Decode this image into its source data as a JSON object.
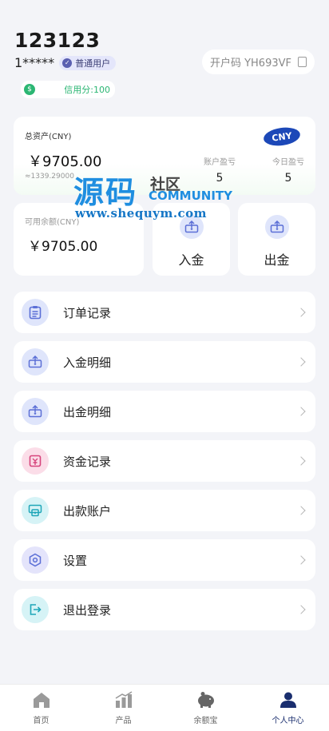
{
  "header": {
    "username": "123123",
    "masked_account": "1*****",
    "badge": "普通用户",
    "invite_label": "开户码 YH693VF",
    "credit_label": "信用分:100"
  },
  "asset": {
    "label": "总资产(CNY)",
    "amount": "￥9705.00",
    "sub_value": "≈1339.29000",
    "currency_pill": "CNY",
    "stats": [
      {
        "label": "账户盈亏",
        "value": "5"
      },
      {
        "label": "今日盈亏",
        "value": "5"
      }
    ]
  },
  "watermark": {
    "big": "源码",
    "she": "社区",
    "community": "COMMUNITY",
    "url": "www.shequym.com"
  },
  "available": {
    "label": "可用余额(CNY)",
    "amount": "￥9705.00"
  },
  "actions": {
    "deposit": "入金",
    "withdraw": "出金"
  },
  "menu": [
    {
      "label": "订单记录",
      "icon": "clipboard-icon",
      "bg": "#dfe5fb"
    },
    {
      "label": "入金明细",
      "icon": "deposit-box-icon",
      "bg": "#dfe5fb"
    },
    {
      "label": "出金明细",
      "icon": "withdraw-box-icon",
      "bg": "#dfe5fb"
    },
    {
      "label": "资金记录",
      "icon": "fund-record-icon",
      "bg": "#fbdde8"
    },
    {
      "label": "出款账户",
      "icon": "atm-icon",
      "bg": "#d6f3f6"
    },
    {
      "label": "设置",
      "icon": "settings-hexagon-icon",
      "bg": "#e4e4fb"
    },
    {
      "label": "退出登录",
      "icon": "logout-icon",
      "bg": "#d6f3f6"
    }
  ],
  "tabs": [
    {
      "label": "首页",
      "icon": "home-icon"
    },
    {
      "label": "产品",
      "icon": "chart-bars-icon"
    },
    {
      "label": "余额宝",
      "icon": "piggy-bank-icon"
    },
    {
      "label": "个人中心",
      "icon": "person-icon"
    }
  ],
  "colors": {
    "accent": "#1c48b8",
    "credit_green": "#2bb673",
    "watermark_blue": "#1f8ee0"
  }
}
